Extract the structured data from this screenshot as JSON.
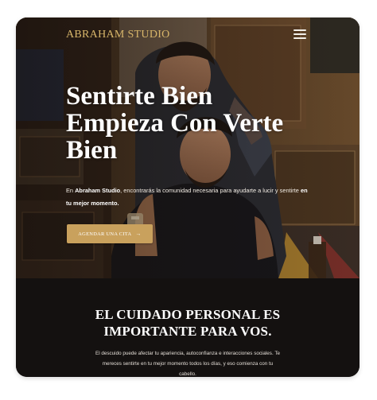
{
  "brand": {
    "name": "ABRAHAM STUDIO"
  },
  "nav": {
    "menu_icon": "hamburger-menu-icon"
  },
  "hero": {
    "headline_line1": "Sentirte Bien",
    "headline_line2": "Empieza Con Verte",
    "headline_line3": "Bien",
    "intro_1": "En ",
    "intro_2": "Abraham Studio",
    "intro_3": ", encontrarás la comunidad necesaria para ayudarte a lucir y sentirte ",
    "intro_4": "en tu mejor momento.",
    "cta_label": "AGENDAR UNA CITA",
    "cta_icon": "arrow-right-icon"
  },
  "care": {
    "title_line1": "EL CUIDADO PERSONAL ES",
    "title_line2": "IMPORTANTE PARA VOS.",
    "body": "El descuido puede afectar tu apariencia, autoconfianza e interacciones sociales. Te mereces sentirte en tu mejor momento todos los días, y eso comienza con tu cabello."
  },
  "colors": {
    "accent_gold": "#c9a15d",
    "logo_gold": "#d8b66a",
    "dark_section": "#141110",
    "text_white": "#ffffff"
  }
}
